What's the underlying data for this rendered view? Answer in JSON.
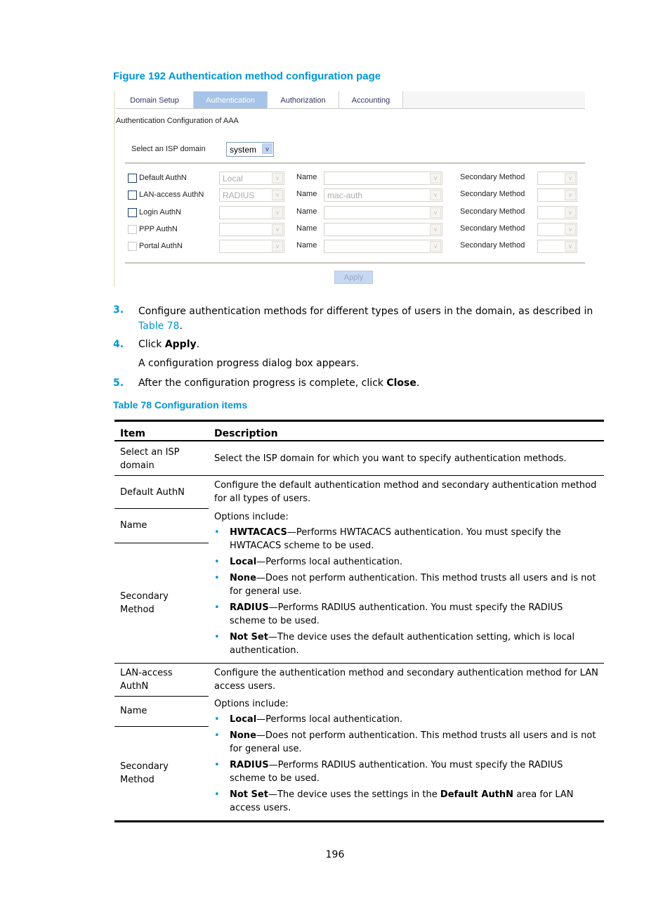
{
  "figure": {
    "caption": "Figure 192 Authentication method configuration page",
    "tabs": [
      {
        "label": "Domain Setup",
        "active": false
      },
      {
        "label": "Authentication",
        "active": true
      },
      {
        "label": "Authorization",
        "active": false
      },
      {
        "label": "Accounting",
        "active": false
      }
    ],
    "section_title": "Authentication Configuration of AAA",
    "isp_label": "Select an ISP domain",
    "isp_value": "system",
    "name_label": "Name",
    "secondary_label": "Secondary Method",
    "rows": [
      {
        "label": "Default AuthN",
        "method": "Local",
        "name": "",
        "secondary": "",
        "enabled": true
      },
      {
        "label": "LAN-access AuthN",
        "method": "RADIUS",
        "name": "mac-auth",
        "secondary": "",
        "enabled": true
      },
      {
        "label": "Login AuthN",
        "method": "",
        "name": "",
        "secondary": "",
        "enabled": true
      },
      {
        "label": "PPP AuthN",
        "method": "",
        "name": "",
        "secondary": "",
        "enabled": false
      },
      {
        "label": "Portal AuthN",
        "method": "",
        "name": "",
        "secondary": "",
        "enabled": false
      }
    ],
    "apply_label": "Apply",
    "arrow_glyph": "v"
  },
  "steps": [
    {
      "num": "3.",
      "text": "Configure authentication methods for different types of users in the domain, as described in ",
      "link": "Table 78",
      "after": "."
    },
    {
      "num": "4.",
      "pre": "Click ",
      "bold": "Apply",
      "after": ".",
      "sub": "A configuration progress dialog box appears."
    },
    {
      "num": "5.",
      "pre": "After the configuration progress is complete, click ",
      "bold": "Close",
      "after": "."
    }
  ],
  "table": {
    "caption": "Table 78 Configuration items",
    "headers": [
      "Item",
      "Description"
    ],
    "rows": {
      "isp": {
        "item": "Select an ISP domain",
        "desc": "Select the ISP domain for which you want to specify authentication methods."
      },
      "default": {
        "item": "Default AuthN",
        "desc": "Configure the default authentication method and secondary authentication method for all types of users."
      },
      "default_name": {
        "item": "Name"
      },
      "default_secondary": {
        "item": "Secondary Method"
      },
      "default_options_intro": "Options include:",
      "default_options": [
        {
          "term": "HWTACACS",
          "text": "—Performs HWTACACS authentication. You must specify the HWTACACS scheme to be used."
        },
        {
          "term": "Local",
          "text": "—Performs local authentication."
        },
        {
          "term": "None",
          "text": "—Does not perform authentication. This method trusts all users and is not for general use."
        },
        {
          "term": "RADIUS",
          "text": "—Performs RADIUS authentication. You must specify the RADIUS scheme to be used."
        },
        {
          "term": "Not Set",
          "text": "—The device uses the default authentication setting, which is local authentication."
        }
      ],
      "lan": {
        "item": "LAN-access AuthN",
        "desc": "Configure the authentication method and secondary authentication method for LAN access users."
      },
      "lan_name": {
        "item": "Name"
      },
      "lan_secondary": {
        "item": "Secondary Method"
      },
      "lan_options_intro": "Options include:",
      "lan_options": [
        {
          "term": "Local",
          "text": "—Performs local authentication."
        },
        {
          "term": "None",
          "text": "—Does not perform authentication. This method trusts all users and is not for general use."
        },
        {
          "term": "RADIUS",
          "text": "—Performs RADIUS authentication. You must specify the RADIUS scheme to be used."
        },
        {
          "term": "Not Set",
          "text": "—The device uses the settings in the ",
          "bold2": "Default AuthN",
          "text2": " area for LAN access users."
        }
      ]
    }
  },
  "page_number": "196"
}
